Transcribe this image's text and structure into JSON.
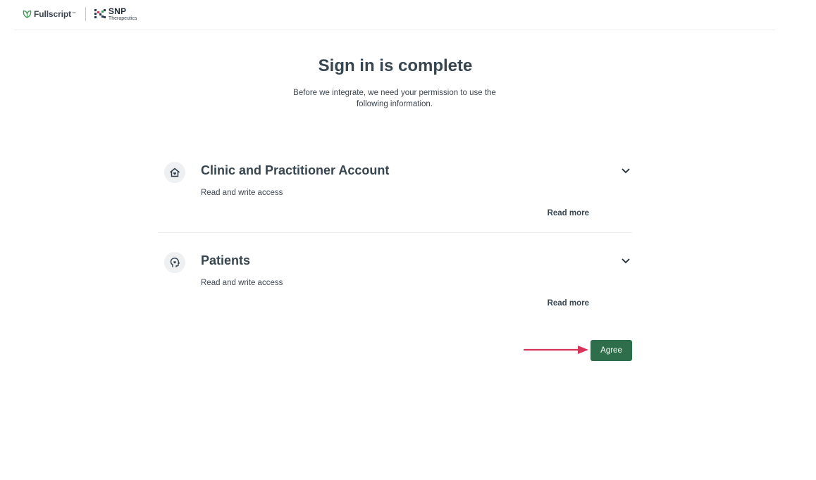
{
  "header": {
    "fullscript_logo_text": "Fullscript",
    "fullscript_trademark": "™",
    "partner_logo_main": "SNP",
    "partner_logo_sub": "Therapeutics"
  },
  "main": {
    "title": "Sign in is complete",
    "subtitle": "Before we integrate, we need your permission to use the following information."
  },
  "permissions": [
    {
      "icon": "clinic-house-icon",
      "title": "Clinic and Practitioner Account",
      "access": "Read and write access",
      "read_more_label": "Read more"
    },
    {
      "icon": "patient-head-icon",
      "title": "Patients",
      "access": "Read and write access",
      "read_more_label": "Read more"
    }
  ],
  "actions": {
    "agree_label": "Agree"
  },
  "colors": {
    "primary_button": "#2f6e4a",
    "annotation_arrow": "#d6345a",
    "text_dark": "#36454f",
    "divider": "#ececec"
  }
}
